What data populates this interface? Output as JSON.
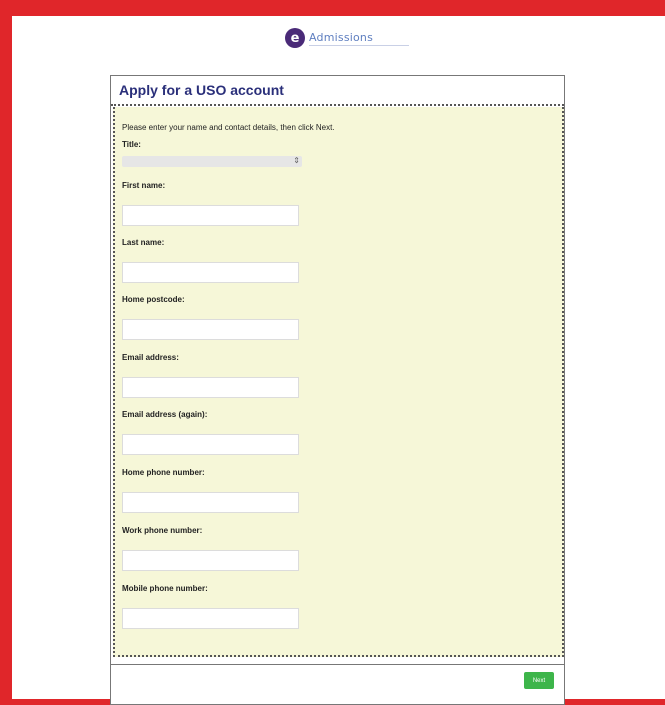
{
  "logo": {
    "letter": "e",
    "text": "Admissions"
  },
  "form": {
    "title": "Apply for a USO account",
    "intro": "Please enter your name and contact details, then click Next.",
    "fields": [
      {
        "label": "Title:",
        "value": ""
      },
      {
        "label": "First name:",
        "value": ""
      },
      {
        "label": "Last name:",
        "value": ""
      },
      {
        "label": "Home postcode:",
        "value": ""
      },
      {
        "label": "Email address:",
        "value": ""
      },
      {
        "label": "Email address (again):",
        "value": ""
      },
      {
        "label": "Home phone number:",
        "value": ""
      },
      {
        "label": "Work phone number:",
        "value": ""
      },
      {
        "label": "Mobile phone number:",
        "value": ""
      }
    ],
    "select_arrows": "⇕",
    "next_label": "Next"
  },
  "colors": {
    "border_red": "#e0262a",
    "form_background": "#f6f7d8",
    "title_color": "#2a2f7a",
    "next_button": "#3db54a"
  }
}
